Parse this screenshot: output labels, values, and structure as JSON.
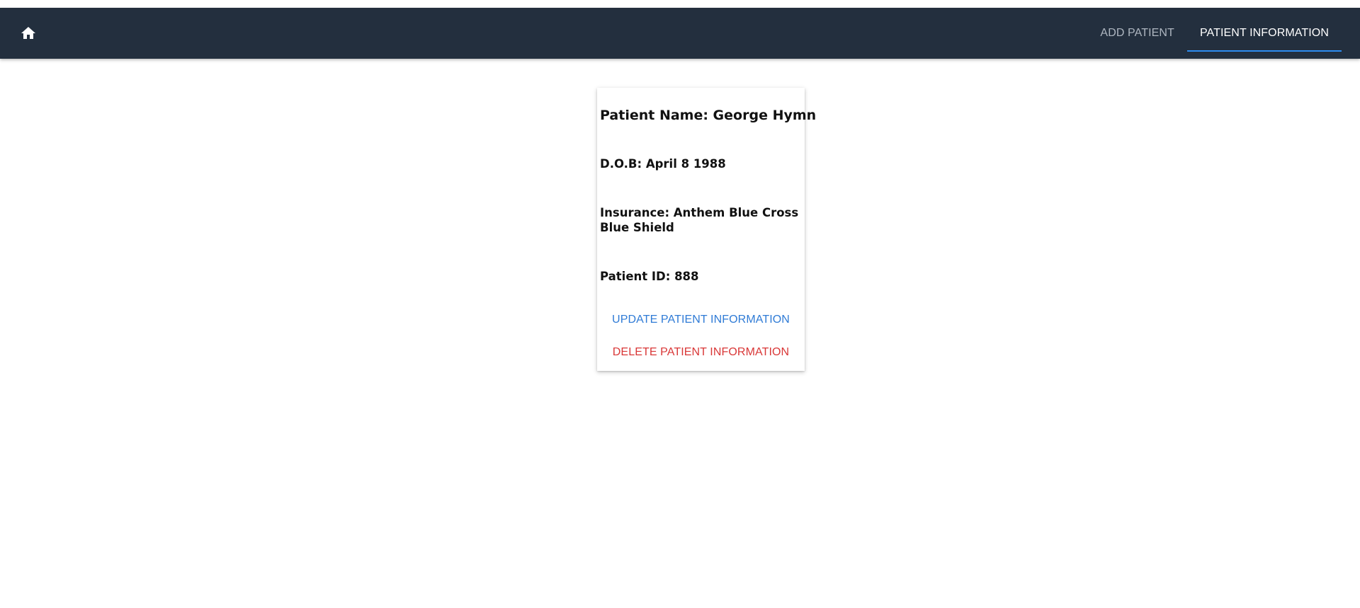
{
  "navbar": {
    "home_icon": "home-icon",
    "tabs": [
      {
        "label": "ADD PATIENT",
        "active": false
      },
      {
        "label": "PATIENT INFORMATION",
        "active": true
      }
    ],
    "accent_color": "#2d8cf0",
    "background_color": "#232f3e"
  },
  "patient_card": {
    "name": "Patient Name: George Hymn",
    "dob": "D.O.B: April 8 1988",
    "insurance": "Insurance: Anthem Blue Cross Blue Shield",
    "patient_id": "Patient ID: 888",
    "update_label": "UPDATE PATIENT INFORMATION",
    "delete_label": "DELETE PATIENT INFORMATION",
    "update_color": "#2f7bd6",
    "delete_color": "#d93737"
  }
}
